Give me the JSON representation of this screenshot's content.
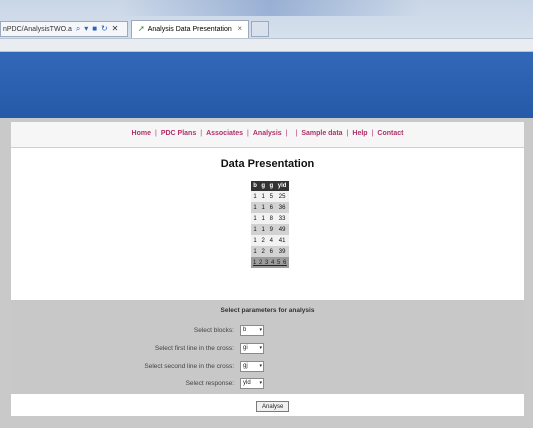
{
  "browser": {
    "url": "nPDC/AnalysisTWO.a",
    "search_glyph": "⌕",
    "dropdown_glyph": "▾",
    "stop_glyph": "■",
    "refresh_glyph": "↻",
    "close_glyph": "✕",
    "tab_icon": "➚",
    "tab_title": "Analysis Data Presentation",
    "tab_close": "×"
  },
  "nav": {
    "items": [
      "Home",
      "PDC Plans",
      "Associates",
      "Analysis",
      "",
      "Sample data",
      "Help",
      "Contact"
    ]
  },
  "page": {
    "title": "Data Presentation"
  },
  "table": {
    "headers": [
      "b",
      "g",
      "g",
      "yld"
    ],
    "rows": [
      [
        "1",
        "1",
        "5",
        "25"
      ],
      [
        "1",
        "1",
        "6",
        "36"
      ],
      [
        "1",
        "1",
        "8",
        "33"
      ],
      [
        "1",
        "1",
        "9",
        "49"
      ],
      [
        "1",
        "2",
        "4",
        "41"
      ],
      [
        "1",
        "2",
        "6",
        "39"
      ]
    ],
    "pager": "1 2 3 4 5 6"
  },
  "params": {
    "heading": "Select parameters for analysis",
    "rows": [
      {
        "label": "Select blocks:",
        "value": "b"
      },
      {
        "label": "Select first line in the cross:",
        "value": "gi"
      },
      {
        "label": "Select second line in the cross:",
        "value": "gj"
      },
      {
        "label": "Select response:",
        "value": "yld"
      }
    ],
    "caret": "▾"
  },
  "actions": {
    "analyse_label": "Analyse"
  },
  "colors": {
    "header_blue": "#2a5fae",
    "nav_link": "#b0306a",
    "panel_gray": "#c8c8c8"
  }
}
